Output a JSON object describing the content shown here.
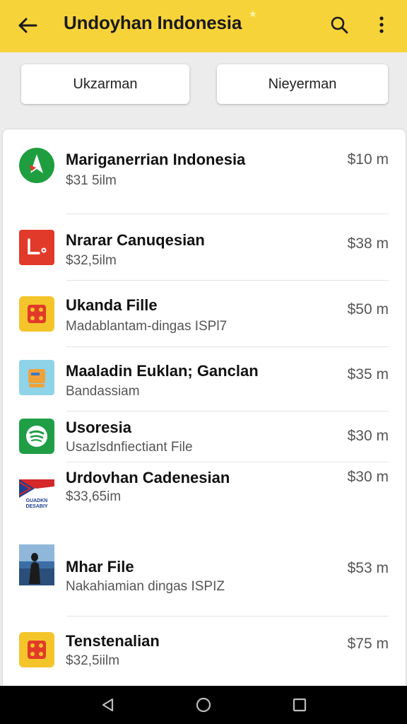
{
  "appbar": {
    "title": "Undoyhan Indonesia",
    "back_icon": "arrow-left-icon",
    "search_icon": "search-icon",
    "more_icon": "more-vert-icon"
  },
  "tabs": [
    {
      "label": "Ukzarman"
    },
    {
      "label": "Nieyerman"
    }
  ],
  "list": [
    {
      "name": "Mariganerrian Indonesia",
      "sub": "$31 5ilm",
      "price": "$10 m",
      "icon": "green-navigation-icon",
      "color": "#1e9e3e"
    },
    {
      "name": "Nrarar Canuqesian",
      "sub": "$32,5ilm",
      "price": "$38 m",
      "icon": "red-app-icon",
      "color": "#e23a2a"
    },
    {
      "name": "Ukanda Fille",
      "sub": "Madablantam-dingas ISPl7",
      "price": "$50 m",
      "icon": "yellow-dice-icon",
      "color": "#f4c52a"
    },
    {
      "name": "Maaladin Euklan; Ganclan",
      "sub": "Bandassiam",
      "price": "$35 m",
      "icon": "light-blue-folder-icon",
      "color": "#8fd3e8"
    },
    {
      "name": "Usoresia",
      "sub": "Usazlsdnfiectiant File",
      "price": "$30 m",
      "icon": "spotify-icon",
      "color": "#1f9e46"
    },
    {
      "name": "Urdovhan Cadenesian",
      "sub": "$33,65im",
      "price": "$30 m",
      "icon": "flag-icon",
      "color": "#d4282a"
    },
    {
      "name": "Mhar File",
      "sub": "Nakahiamian dingas ISPIZ",
      "price": "$53 m",
      "icon": "photo-thumbnail-icon",
      "color": "#3a6ea5"
    },
    {
      "name": "Tenstenalian",
      "sub": "$32,5iilm",
      "price": "$75 m",
      "icon": "yellow-dice-icon",
      "color": "#f4c52a"
    }
  ],
  "flag_text": "GUADKN DESABIY",
  "navbar": {
    "back_icon": "nav-back-icon",
    "home_icon": "nav-home-icon",
    "recents_icon": "nav-recents-icon"
  }
}
